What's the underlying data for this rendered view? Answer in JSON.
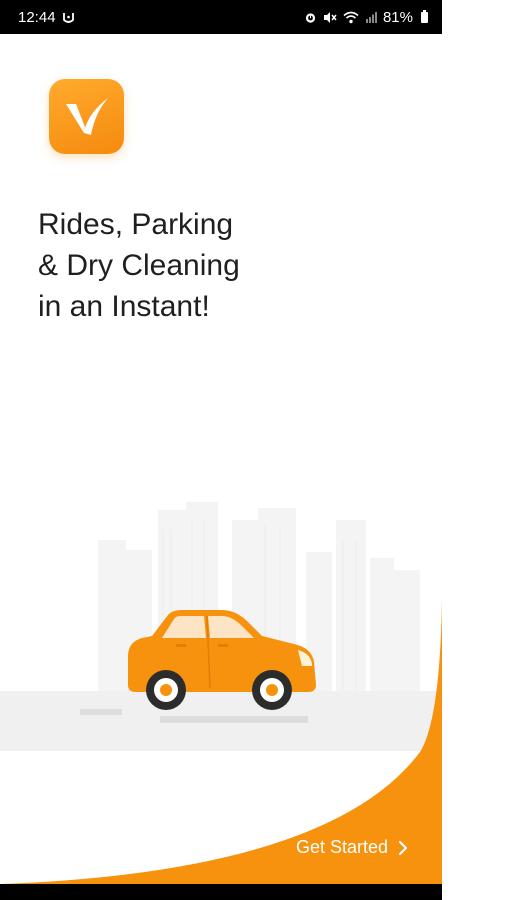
{
  "status_bar": {
    "time": "12:44",
    "battery": "81%"
  },
  "app": {
    "logo_icon": "v-check-logo",
    "brand_color": "#f7920f"
  },
  "headline": {
    "lines": [
      "Rides, Parking",
      "& Dry Cleaning",
      "in an Instant!"
    ]
  },
  "illustration": {
    "subject": "orange-car-city-icon",
    "car_color": "#f7920f"
  },
  "cta": {
    "label": "Get Started",
    "icon": "chevron-right-icon"
  }
}
